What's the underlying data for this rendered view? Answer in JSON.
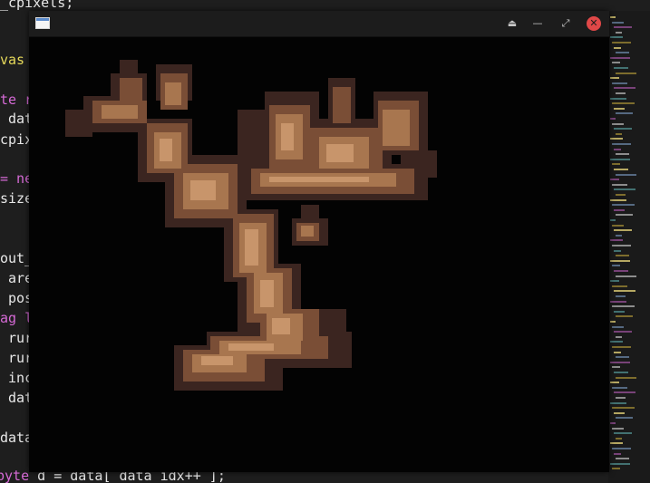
{
  "editor": {
    "lines": [
      {
        "text": "_cpixels;"
      },
      {
        "text": "vas"
      },
      {
        "text": "te r"
      },
      {
        "text": " dat"
      },
      {
        "text": "cpix"
      },
      {
        "text": "= ne"
      },
      {
        "text": "size"
      },
      {
        "text": "out_"
      },
      {
        "text": " are"
      },
      {
        "text": " pos"
      },
      {
        "text": "ag l"
      },
      {
        "text": " rur"
      },
      {
        "text": " rur"
      },
      {
        "text": " inc"
      },
      {
        "text": " dat"
      },
      {
        "text": "data"
      },
      {
        "text": "byte d = data[ data_idx++ ];"
      }
    ]
  },
  "window": {
    "title": "",
    "icons": {
      "app": "window-app-icon",
      "eject": "eject-icon",
      "minimize": "minimize-icon",
      "maximize": "maximize-icon",
      "close": "close-icon"
    },
    "controls": {
      "eject": "⏏",
      "minimize": "—",
      "maximize": "⤢",
      "close": "✕"
    },
    "close_color": "#e04848"
  },
  "canvas": {
    "content": "pixel-art tree",
    "colors": {
      "background": "#030303",
      "shadow": "#3b2520",
      "mid": "#7a4e36",
      "light": "#a8764f",
      "highlight": "#c8956b"
    }
  }
}
